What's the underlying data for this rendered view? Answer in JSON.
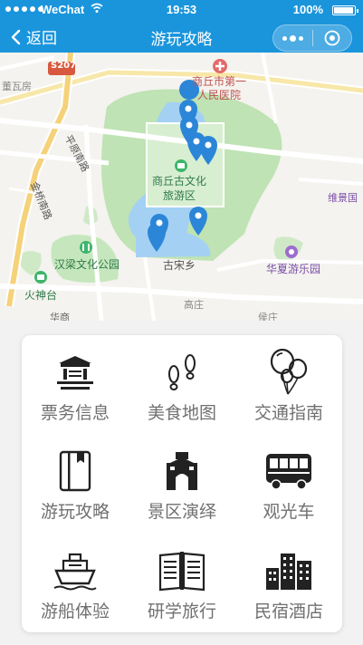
{
  "status_bar": {
    "carrier": "WeChat",
    "time": "19:53",
    "battery": "100%"
  },
  "nav": {
    "back_label": "返回",
    "title": "游玩攻略"
  },
  "map": {
    "labels": {
      "road_s207": "S207",
      "dongwafang": "董瓦房",
      "hospital": "商丘市第一\n人民医院",
      "pingyuan_road": "平原南路",
      "jinqiao_road": "金桥南路",
      "scenic_area": "商丘古文化\n旅游区",
      "weijing": "维景国",
      "hanliang_park": "汉梁文化公园",
      "guzong": "古宋乡",
      "huaxia_park": "华夏游乐园",
      "huoshentai": "火神台",
      "gaozhuang": "高庄",
      "houzhuang": "侯庄",
      "hua_road": "华商"
    }
  },
  "menu": {
    "items": [
      {
        "label": "票务信息",
        "icon": "ticket-gate-icon"
      },
      {
        "label": "美食地图",
        "icon": "footprints-icon"
      },
      {
        "label": "交通指南",
        "icon": "balloons-icon"
      },
      {
        "label": "游玩攻略",
        "icon": "guidebook-icon"
      },
      {
        "label": "景区演绎",
        "icon": "city-gate-icon"
      },
      {
        "label": "观光车",
        "icon": "tour-bus-icon"
      },
      {
        "label": "游船体验",
        "icon": "cruise-ship-icon"
      },
      {
        "label": "研学旅行",
        "icon": "open-book-icon"
      },
      {
        "label": "民宿酒店",
        "icon": "hotel-buildings-icon"
      }
    ]
  },
  "colors": {
    "nav_bg": "#1a95dc",
    "park_green": "#bfe3b4",
    "water_blue": "#a4d1f3",
    "marker_blue": "#2b86d8",
    "label_gray": "#707070"
  }
}
